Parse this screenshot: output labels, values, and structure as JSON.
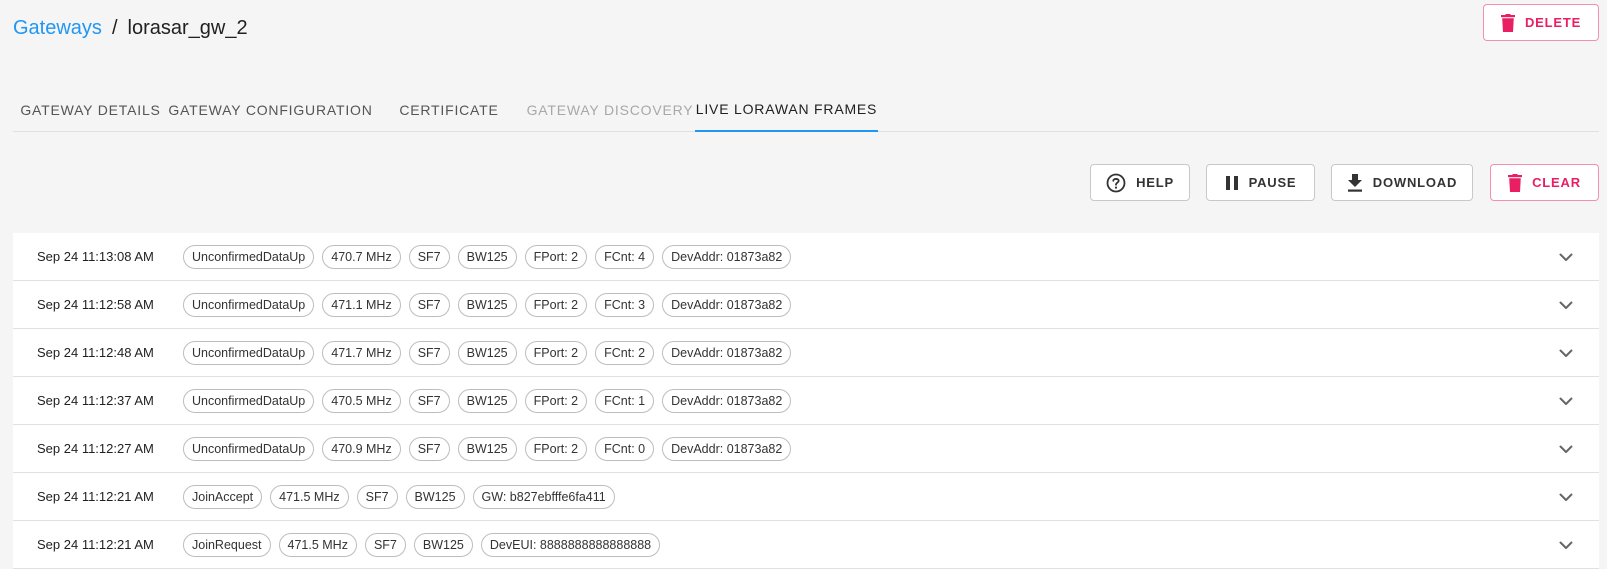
{
  "breadcrumb": {
    "parent": "Gateways",
    "separator": "/",
    "current": "lorasar_gw_2"
  },
  "header": {
    "delete_label": "DELETE"
  },
  "tabs": [
    {
      "label": "GATEWAY DETAILS",
      "state": "normal"
    },
    {
      "label": "GATEWAY CONFIGURATION",
      "state": "normal"
    },
    {
      "label": "CERTIFICATE",
      "state": "normal"
    },
    {
      "label": "GATEWAY DISCOVERY",
      "state": "disabled"
    },
    {
      "label": "LIVE LORAWAN FRAMES",
      "state": "active"
    }
  ],
  "toolbar": {
    "help_label": "HELP",
    "pause_label": "PAUSE",
    "download_label": "DOWNLOAD",
    "clear_label": "CLEAR"
  },
  "frames": [
    {
      "time": "Sep 24 11:13:08 AM",
      "chips": [
        "UnconfirmedDataUp",
        "470.7 MHz",
        "SF7",
        "BW125",
        "FPort: 2",
        "FCnt: 4",
        "DevAddr: 01873a82"
      ]
    },
    {
      "time": "Sep 24 11:12:58 AM",
      "chips": [
        "UnconfirmedDataUp",
        "471.1 MHz",
        "SF7",
        "BW125",
        "FPort: 2",
        "FCnt: 3",
        "DevAddr: 01873a82"
      ]
    },
    {
      "time": "Sep 24 11:12:48 AM",
      "chips": [
        "UnconfirmedDataUp",
        "471.7 MHz",
        "SF7",
        "BW125",
        "FPort: 2",
        "FCnt: 2",
        "DevAddr: 01873a82"
      ]
    },
    {
      "time": "Sep 24 11:12:37 AM",
      "chips": [
        "UnconfirmedDataUp",
        "470.5 MHz",
        "SF7",
        "BW125",
        "FPort: 2",
        "FCnt: 1",
        "DevAddr: 01873a82"
      ]
    },
    {
      "time": "Sep 24 11:12:27 AM",
      "chips": [
        "UnconfirmedDataUp",
        "470.9 MHz",
        "SF7",
        "BW125",
        "FPort: 2",
        "FCnt: 0",
        "DevAddr: 01873a82"
      ]
    },
    {
      "time": "Sep 24 11:12:21 AM",
      "chips": [
        "JoinAccept",
        "471.5 MHz",
        "SF7",
        "BW125",
        "GW: b827ebfffe6fa411"
      ]
    },
    {
      "time": "Sep 24 11:12:21 AM",
      "chips": [
        "JoinRequest",
        "471.5 MHz",
        "SF7",
        "BW125",
        "DevEUI: 8888888888888888"
      ]
    }
  ],
  "icons": {
    "delete": "trash-icon",
    "help": "help-circle-icon",
    "pause": "pause-icon",
    "download": "download-icon",
    "clear": "trash-icon",
    "expand": "chevron-down-icon"
  },
  "colors": {
    "link": "#2196f3",
    "danger": "#e91e63",
    "tab_indicator": "#2196f3"
  }
}
